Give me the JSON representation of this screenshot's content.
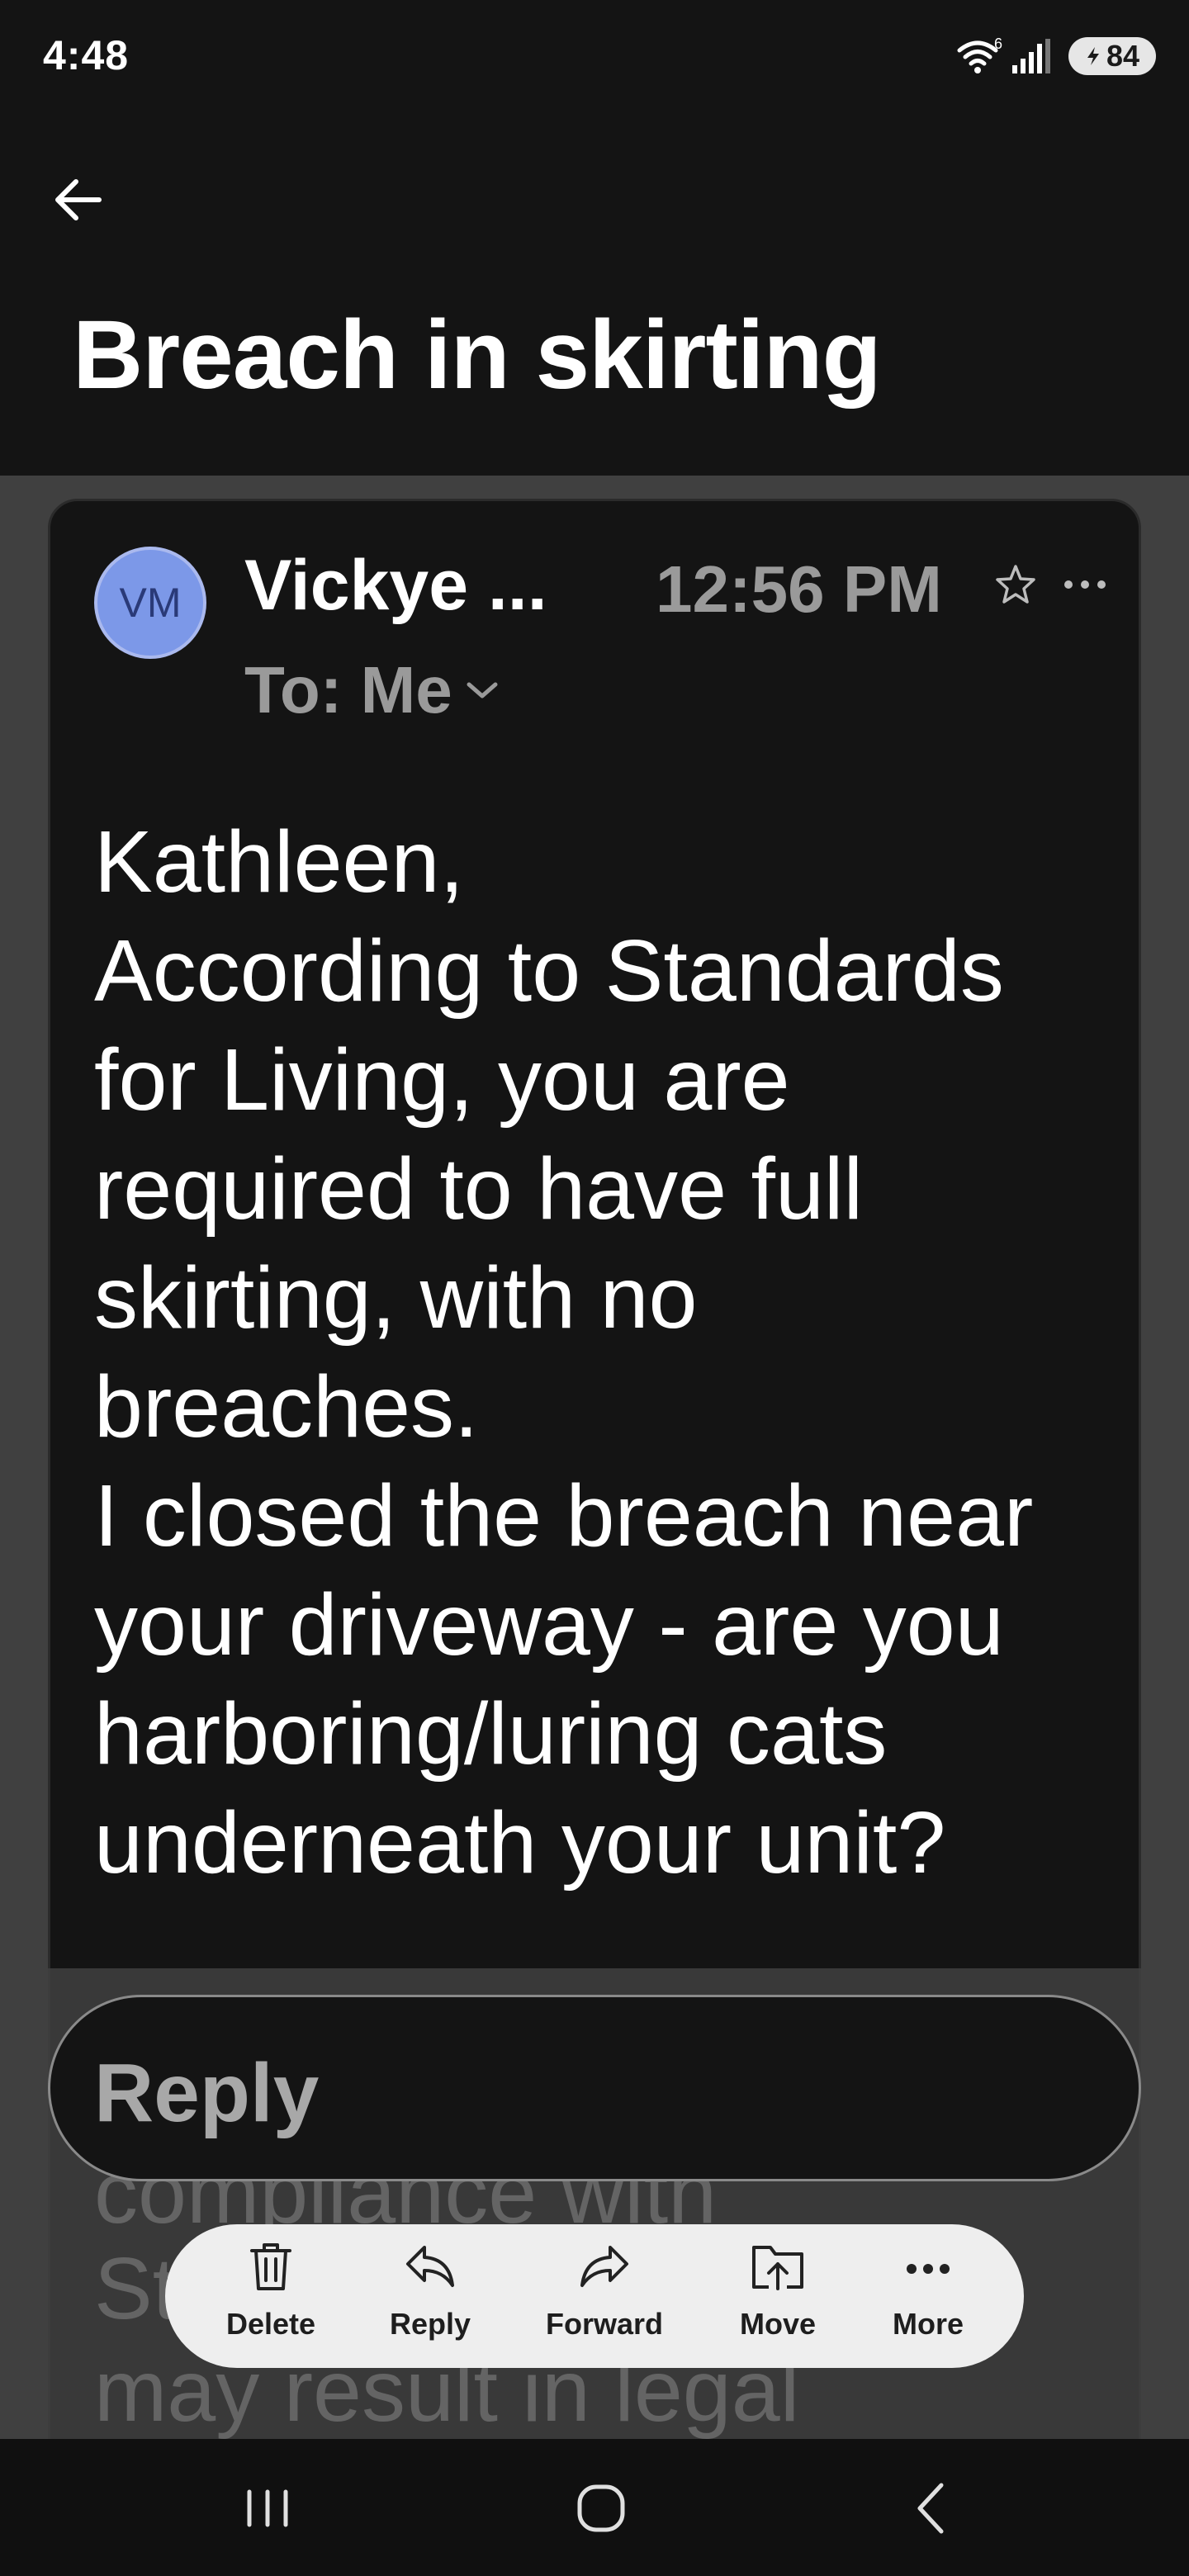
{
  "status_bar": {
    "time": "4:48",
    "network_label": "6",
    "battery": "84",
    "icons": [
      "wifi-icon",
      "signal-icon",
      "battery-icon"
    ]
  },
  "header": {
    "back_icon": "arrow-left-icon",
    "subject": "Breach in skirting"
  },
  "message": {
    "avatar_initials": "VM",
    "avatar_color": "#7c98e8",
    "sender": "Vickye ...",
    "time": "12:56 PM",
    "to_label": "To: Me",
    "star_icon": "star-outline-icon",
    "more_icon": "more-horizontal-icon",
    "body_lines": [
      "Kathleen,",
      "According to Standards",
      "for Living, you are",
      "required to have full",
      "skirting, with no",
      "breaches.",
      "I closed the breach near",
      "your driveway - are you",
      "harboring/luring cats",
      "underneath your unit?"
    ],
    "obscured_lines": [
      "compliance with",
      "St",
      "may result in legal"
    ]
  },
  "reply_box": {
    "placeholder": "Reply"
  },
  "action_bar": {
    "items": [
      {
        "label": "Delete",
        "icon": "trash-icon"
      },
      {
        "label": "Reply",
        "icon": "reply-icon"
      },
      {
        "label": "Forward",
        "icon": "forward-icon"
      },
      {
        "label": "Move",
        "icon": "move-to-folder-icon"
      },
      {
        "label": "More",
        "icon": "more-horizontal-icon"
      }
    ]
  },
  "nav_bar": {
    "icons": [
      "recent-apps-icon",
      "home-icon",
      "back-icon"
    ]
  }
}
